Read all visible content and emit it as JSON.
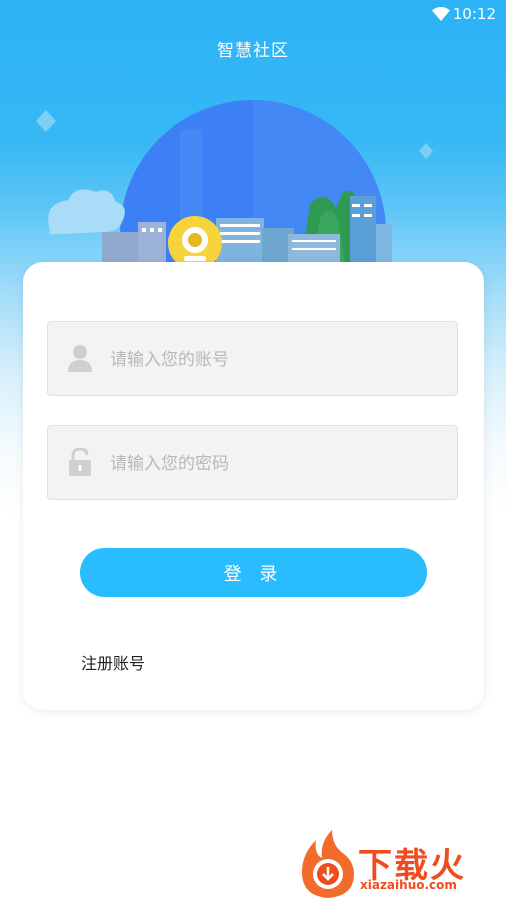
{
  "status_bar": {
    "time": "10:12",
    "wifi_icon": "wifi-icon"
  },
  "header": {
    "title": "智慧社区"
  },
  "hero": {
    "illustration": "city-skyline-illustration"
  },
  "login_form": {
    "username_placeholder": "请输入您的账号",
    "username_icon": "user-icon",
    "password_placeholder": "请输入您的密码",
    "password_icon": "lock-icon",
    "login_label": "登 录",
    "register_label": "注册账号"
  },
  "watermark": {
    "brand": "下载火",
    "url": "xiazaihuo.com"
  },
  "colors": {
    "primary": "#29bcff",
    "header_blue": "#2cb3f6",
    "watermark": "#ef4d1f"
  }
}
